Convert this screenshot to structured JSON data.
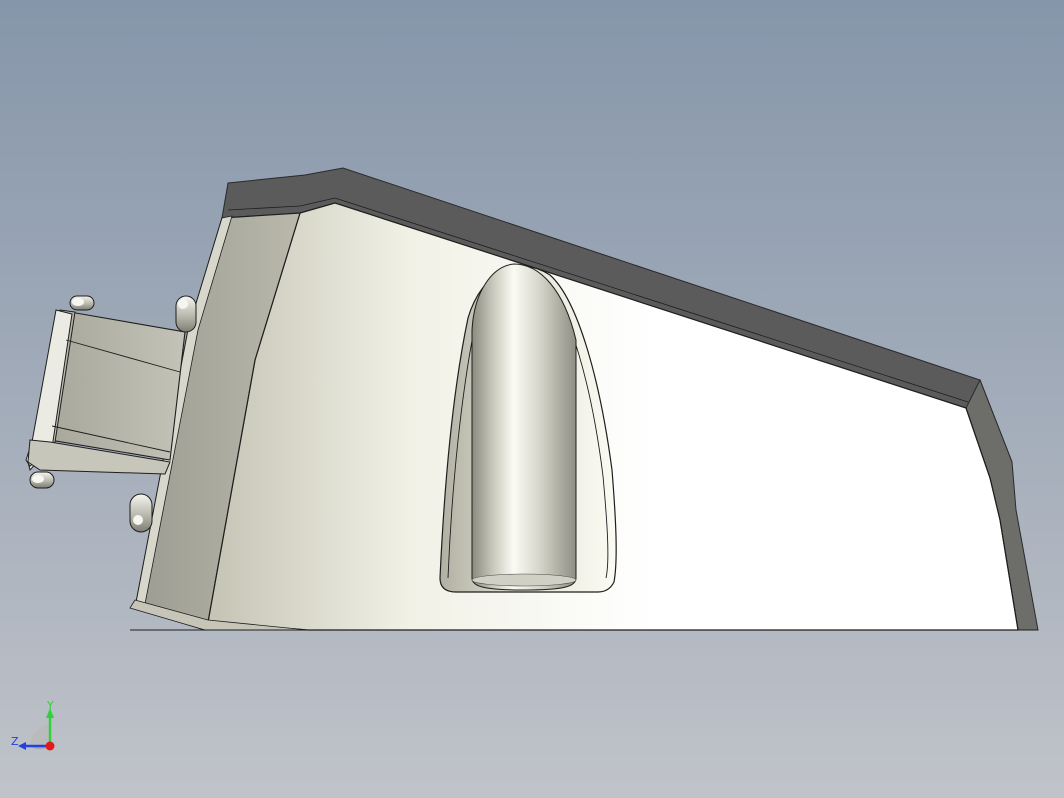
{
  "viewport": {
    "background_top": "#8696aa",
    "background_bottom": "#c0c3c9"
  },
  "triad": {
    "y_label": "Y",
    "z_label": "Z",
    "y_color": "#2fd23a",
    "z_color": "#2340e0",
    "x_color": "#e11b1b"
  }
}
